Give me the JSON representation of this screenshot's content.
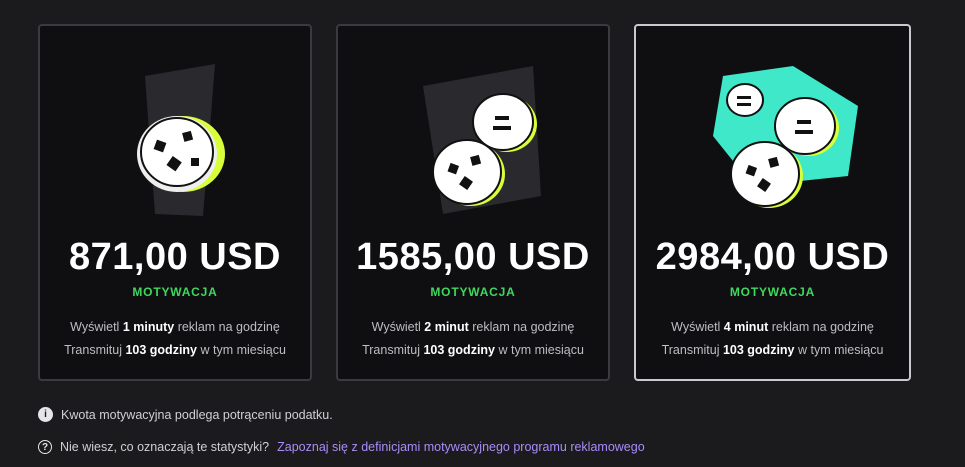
{
  "cards": [
    {
      "amount": "871,00 USD",
      "motivation_label": "MOTYWACJA",
      "line1": {
        "pre": "Wyświetl ",
        "bold": "1 minuty",
        "post": " reklam na godzinę"
      },
      "line2": {
        "pre": "Transmituj ",
        "bold": "103 godziny",
        "post": " w tym miesiącu"
      },
      "selected": false
    },
    {
      "amount": "1585,00 USD",
      "motivation_label": "MOTYWACJA",
      "line1": {
        "pre": "Wyświetl ",
        "bold": "2 minut",
        "post": " reklam na godzinę"
      },
      "line2": {
        "pre": "Transmituj ",
        "bold": "103 godziny",
        "post": " w tym miesiącu"
      },
      "selected": false
    },
    {
      "amount": "2984,00 USD",
      "motivation_label": "MOTYWACJA",
      "line1": {
        "pre": "Wyświetl ",
        "bold": "4 minut",
        "post": " reklam na godzinę"
      },
      "line2": {
        "pre": "Transmituj ",
        "bold": "103 godziny",
        "post": " w tym miesiącu"
      },
      "selected": true
    }
  ],
  "notes": {
    "tax_note": "Kwota motywacyjna podlega potrąceniu podatku.",
    "help_text": "Nie wiesz, co oznaczają te statystyki?",
    "help_link": "Zapoznaj się z definicjami motywacyjnego programu reklamowego",
    "info_icon": "info-icon",
    "help_icon": "question-icon"
  },
  "colors": {
    "accent_green": "#3fd85f",
    "link_purple": "#a98cf7",
    "selected_backdrop": "#3ee8c8",
    "coin_outline": "#d9ff3a"
  }
}
